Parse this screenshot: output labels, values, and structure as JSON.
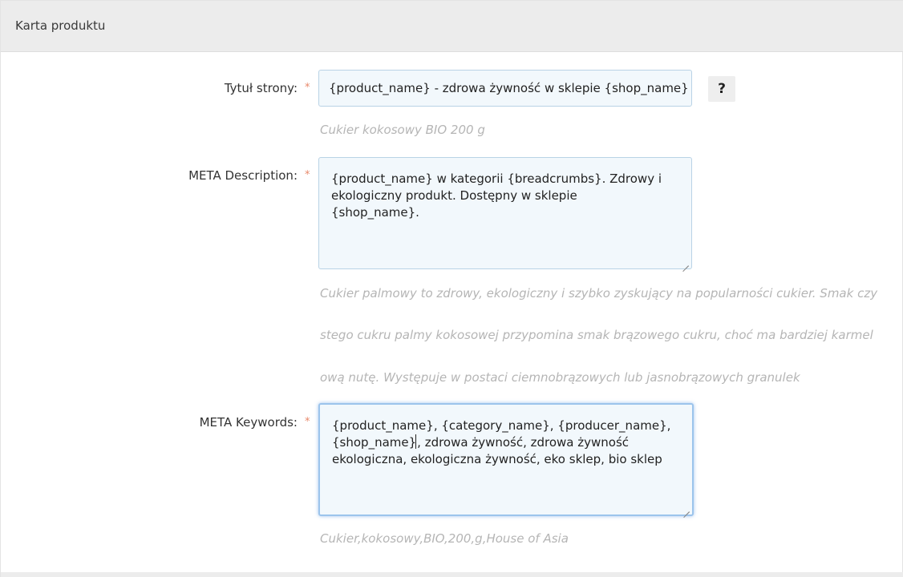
{
  "panel": {
    "title": "Karta produktu"
  },
  "fields": {
    "title": {
      "label": "Tytuł strony:",
      "required_mark": "*",
      "value": "{product_name} - zdrowa żywność w sklepie {shop_name}",
      "hint": "Cukier kokosowy BIO 200 g",
      "help_label": "?"
    },
    "description": {
      "label": "META Description:",
      "required_mark": "*",
      "value_lines": [
        "{product_name} w kategorii {breadcrumbs}. Zdrowy i",
        "ekologiczny produkt. Dostępny w sklepie",
        "{shop_name}."
      ],
      "hint_lines": [
        "Cukier palmowy to zdrowy, ekologiczny i szybko zyskujący na popularności cukier. Smak czy",
        "stego cukru palmy kokosowej przypomina smak brązowego cukru, choć ma bardziej karmel",
        "ową nutę. Występuje w postaci ciemnobrązowych lub jasnobrązowych granulek"
      ]
    },
    "keywords": {
      "label": "META Keywords:",
      "required_mark": "*",
      "value_line1": "{product_name}, {category_name}, {producer_name},",
      "value_line2_before_caret": "{shop_name}",
      "value_line2_after_caret": ", zdrowa żywność, zdrowa żywność",
      "value_line3": "ekologiczna, ekologiczna żywność, eko sklep, bio sklep",
      "hint": "Cukier,kokosowy,BIO,200,g,House of Asia"
    }
  },
  "colors": {
    "header_bg": "#ececec",
    "field_bg": "#f2f8fc",
    "field_border": "#b9d3e6",
    "focus_border": "#9cc4ec",
    "required": "#e8896b",
    "hint_text": "#b5b5b5"
  }
}
